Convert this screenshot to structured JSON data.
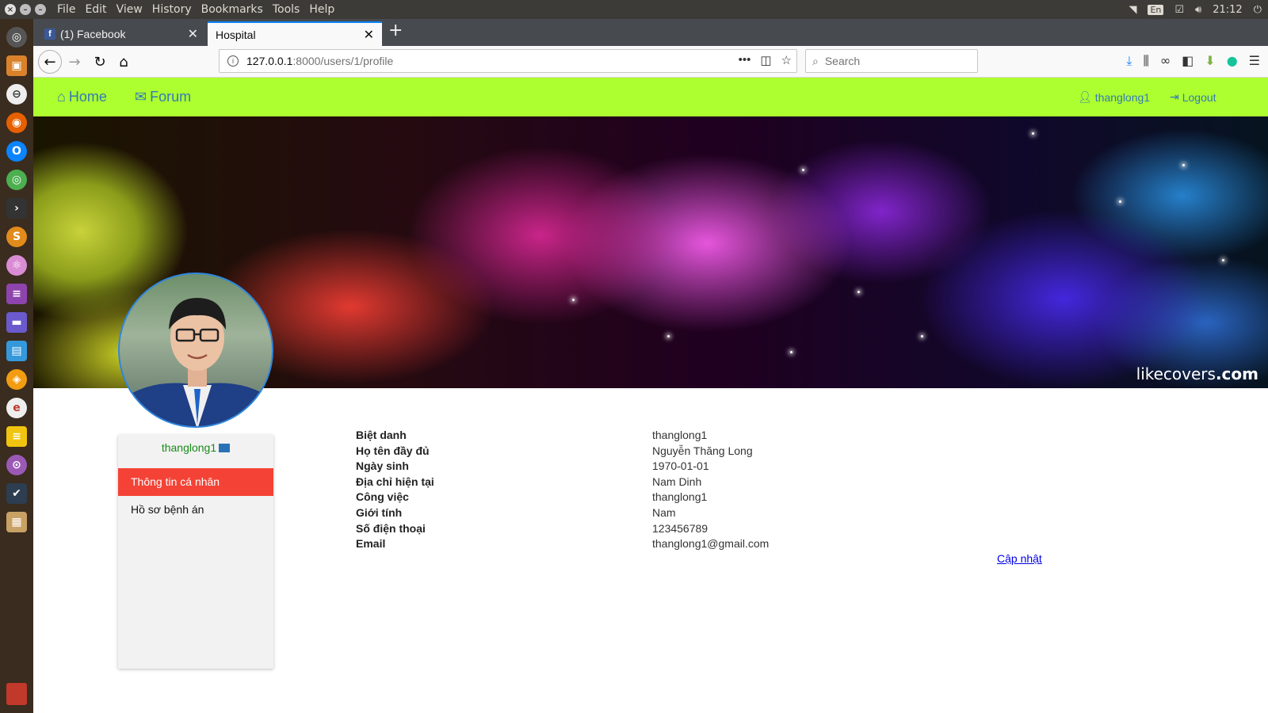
{
  "os": {
    "menu": [
      "File",
      "Edit",
      "View",
      "History",
      "Bookmarks",
      "Tools",
      "Help"
    ],
    "lang": "En",
    "clock": "21:12"
  },
  "browser": {
    "tabs": [
      {
        "label": "(1) Facebook"
      },
      {
        "label": "Hospital"
      }
    ],
    "url_host": "127.0.0.1",
    "url_rest": ":8000/users/1/profile",
    "search_placeholder": "Search"
  },
  "site": {
    "nav": {
      "home": "Home",
      "forum": "Forum",
      "user": "thanglong1",
      "logout": "Logout"
    },
    "cover_watermark_light": "likecovers",
    "cover_watermark_bold": ".com",
    "sidebar": {
      "username": "thanglong1",
      "items": [
        {
          "label": "Thông tin cá nhân",
          "active": true
        },
        {
          "label": "Hồ sơ bệnh án",
          "active": false
        }
      ]
    },
    "profile": {
      "rows": [
        {
          "label": "Biệt danh",
          "value": "thanglong1"
        },
        {
          "label": "Họ tên đầy đủ",
          "value": "Nguyễn Thăng Long"
        },
        {
          "label": "Ngày sinh",
          "value": "1970-01-01"
        },
        {
          "label": "Địa chỉ hiện tại",
          "value": "Nam Dinh"
        },
        {
          "label": "Công việc",
          "value": "thanglong1"
        },
        {
          "label": "Giới tính",
          "value": "Nam"
        },
        {
          "label": "Số điện thoại",
          "value": "123456789"
        },
        {
          "label": "Email",
          "value": "thanglong1@gmail.com"
        }
      ],
      "update_label": "Cập nhật"
    }
  },
  "colors": {
    "site_nav_bg": "#adff2f",
    "link": "#337ab7",
    "active_menu": "#f44336"
  }
}
